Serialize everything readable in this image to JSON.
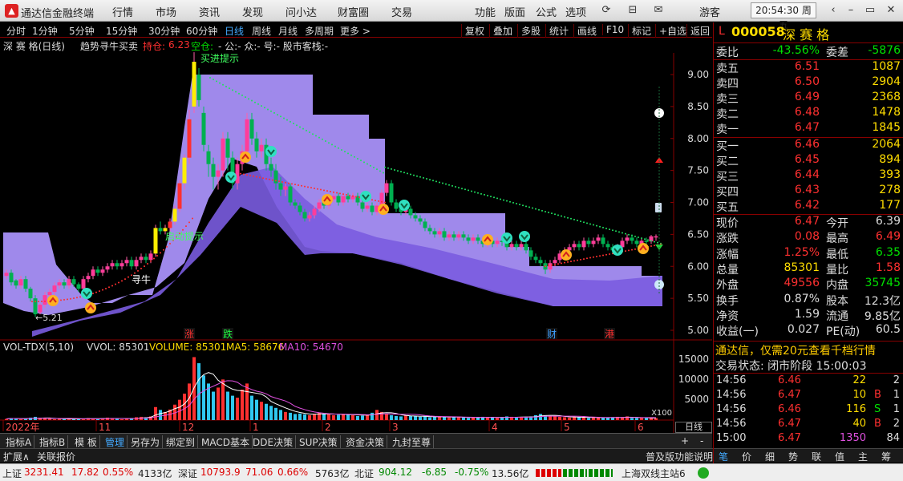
{
  "titlebar": {
    "app_title": "通达信金融终端",
    "menus": [
      "行情",
      "市场",
      "资讯",
      "发现",
      "问小达",
      "财富圈",
      "交易"
    ],
    "func_menus": [
      "功能",
      "版面",
      "公式",
      "选项"
    ],
    "user": "游客",
    "clock": "20:54:30 周五"
  },
  "periods": [
    "分时",
    "1分钟",
    "5分钟",
    "15分钟",
    "30分钟",
    "60分钟",
    "日线",
    "周线",
    "月线",
    "多周期",
    "更多 >"
  ],
  "tools": [
    "复权",
    "叠加",
    "多股",
    "统计",
    "画线",
    "F10",
    "标记",
    "+自选",
    "返回"
  ],
  "main_legend": {
    "name": "深 赛 格(日线)",
    "indicator": "趋势寻牛买卖",
    "hold_label": "持仓:",
    "hold_value": "6.23",
    "empty_label": "空仓:",
    "rest": "- 公:- 众:- 号:- 股市客栈:-"
  },
  "price_axis": [
    "9.00",
    "8.50",
    "8.00",
    "7.50",
    "7.00",
    "6.50",
    "6.00",
    "5.50",
    "5.00"
  ],
  "annotations": {
    "top_tip": "买进提示",
    "mid_tip": "启动提示",
    "bull": "寻牛",
    "low": "←5.21",
    "events": [
      "涨",
      "跌",
      "财",
      "港"
    ]
  },
  "vol_legend": {
    "title": "VOL-TDX(5,10)",
    "vvol": "VVOL: 85301",
    "volume": "VOLUME: 85301",
    "ma5": "MA5: 58676",
    "ma10": "MA10: 54670"
  },
  "vol_axis": [
    "15000",
    "10000",
    "5000"
  ],
  "vol_unit": "X100",
  "date_axis": [
    "2022年",
    "11",
    "12",
    "1",
    "2",
    "3",
    "4",
    "5",
    "6"
  ],
  "side_buttons": {
    "period": "日线",
    "plus": "+",
    "minus": "-",
    "close": "×"
  },
  "bottom_tabs": [
    "指标A",
    "指标B",
    "模 板",
    "管理",
    "另存为",
    "绑定到",
    "MACD基本",
    "DDE决策",
    "SUP决策",
    "资金决策",
    "九封至尊"
  ],
  "bottom2": [
    "扩展∧",
    "关联报价"
  ],
  "bottom2_right": "普及版功能说明",
  "right_tabs": [
    "笔",
    "价",
    "细",
    "势",
    "联",
    "值",
    "主",
    "筹"
  ],
  "stock": {
    "flag": "L",
    "code": "000058",
    "name": "深 赛 格"
  },
  "weibi": {
    "label": "委比",
    "value": "-43.56%",
    "label2": "委差",
    "value2": "-5876"
  },
  "asks": [
    {
      "l": "卖五",
      "p": "6.51",
      "v": "1087"
    },
    {
      "l": "卖四",
      "p": "6.50",
      "v": "2904"
    },
    {
      "l": "卖三",
      "p": "6.49",
      "v": "2368"
    },
    {
      "l": "卖二",
      "p": "6.48",
      "v": "1478"
    },
    {
      "l": "卖一",
      "p": "6.47",
      "v": "1845"
    }
  ],
  "bids": [
    {
      "l": "买一",
      "p": "6.46",
      "v": "2064"
    },
    {
      "l": "买二",
      "p": "6.45",
      "v": "894"
    },
    {
      "l": "买三",
      "p": "6.44",
      "v": "393"
    },
    {
      "l": "买四",
      "p": "6.43",
      "v": "278"
    },
    {
      "l": "买五",
      "p": "6.42",
      "v": "177"
    }
  ],
  "quote": [
    {
      "a": "现价",
      "av": "6.47",
      "b": "今开",
      "bv": "6.39",
      "ac": "red",
      "bc": "wht"
    },
    {
      "a": "涨跌",
      "av": "0.08",
      "b": "最高",
      "bv": "6.49",
      "ac": "red",
      "bc": "red"
    },
    {
      "a": "涨幅",
      "av": "1.25%",
      "b": "最低",
      "bv": "6.35",
      "ac": "red",
      "bc": "grn"
    },
    {
      "a": "总量",
      "av": "85301",
      "b": "量比",
      "bv": "1.58",
      "ac": "yel",
      "bc": "red"
    },
    {
      "a": "外盘",
      "av": "49556",
      "b": "内盘",
      "bv": "35745",
      "ac": "red",
      "bc": "grn"
    },
    {
      "a": "换手",
      "av": "0.87%",
      "b": "股本",
      "bv": "12.3亿",
      "ac": "wht",
      "bc": "wht"
    },
    {
      "a": "净资",
      "av": "1.59",
      "b": "流通",
      "bv": "9.85亿",
      "ac": "wht",
      "bc": "wht"
    },
    {
      "a": "收益(一)",
      "av": "0.027",
      "b": "PE(动)",
      "bv": "60.5",
      "ac": "wht",
      "bc": "wht"
    }
  ],
  "promo": "通达信，仅需20元查看千档行情",
  "trade_state": {
    "label": "交易状态:",
    "value": "闭市阶段 15:00:03"
  },
  "ticks": [
    {
      "t": "14:56",
      "p": "6.46",
      "v": "22",
      "f": "",
      "n": "2",
      "pc": "red",
      "vc": "yel"
    },
    {
      "t": "14:56",
      "p": "6.47",
      "v": "10",
      "f": "B",
      "n": "1",
      "pc": "red",
      "vc": "yel"
    },
    {
      "t": "14:56",
      "p": "6.46",
      "v": "116",
      "f": "S",
      "n": "1",
      "pc": "red",
      "vc": "yel"
    },
    {
      "t": "14:56",
      "p": "6.47",
      "v": "40",
      "f": "B",
      "n": "2",
      "pc": "red",
      "vc": "yel"
    },
    {
      "t": "15:00",
      "p": "6.47",
      "v": "1350",
      "f": "",
      "n": "84",
      "pc": "red",
      "vc": "pur"
    }
  ],
  "status": {
    "sh": "上证",
    "sh_v": "3231.41",
    "sh_c": "17.82",
    "sh_p": "0.55%",
    "sh_a": "4133亿",
    "sz": "深证",
    "sz_v": "10793.9",
    "sz_c": "71.06",
    "sz_p": "0.66%",
    "sz_a": "5763亿",
    "bz": "北证",
    "bz_v": "904.12",
    "bz_c": "-6.85",
    "bz_p": "-0.75%",
    "bz_a": "13.56亿",
    "server": "上海双线主站6"
  }
}
